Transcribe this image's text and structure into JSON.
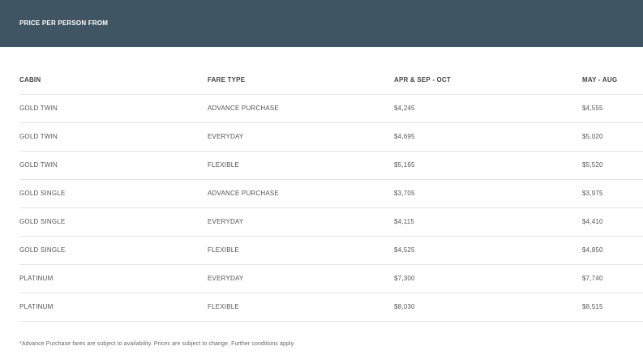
{
  "header": {
    "title": "PRICE PER PERSON FROM"
  },
  "table": {
    "columns": [
      "CABIN",
      "FARE TYPE",
      "APR & SEP - OCT",
      "MAY - AUG"
    ],
    "rows": [
      [
        "GOLD TWIN",
        "ADVANCE PURCHASE",
        "$4,245",
        "$4,555"
      ],
      [
        "GOLD TWIN",
        "EVERYDAY",
        "$4,695",
        "$5,020"
      ],
      [
        "GOLD TWIN",
        "FLEXIBLE",
        "$5,165",
        "$5,520"
      ],
      [
        "GOLD SINGLE",
        "ADVANCE PURCHASE",
        "$3,705",
        "$3,975"
      ],
      [
        "GOLD SINGLE",
        "EVERYDAY",
        "$4,115",
        "$4,410"
      ],
      [
        "GOLD SINGLE",
        "FLEXIBLE",
        "$4,525",
        "$4,850"
      ],
      [
        "PLATINUM",
        "EVERYDAY",
        "$7,300",
        "$7,740"
      ],
      [
        "PLATINUM",
        "FLEXIBLE",
        "$8,030",
        "$8,515"
      ]
    ]
  },
  "footnote": "*Advance Purchase fares are subject to availability. Prices are subject to change. Further conditions apply.",
  "colors": {
    "header_bg": "#3f5563",
    "divider": "#e4e4e4"
  }
}
